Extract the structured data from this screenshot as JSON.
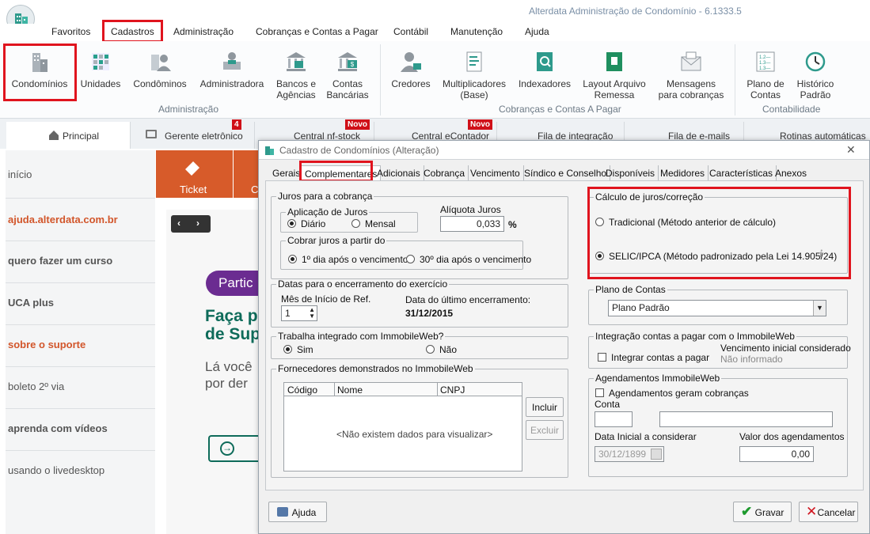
{
  "app": {
    "title": "Alterdata Administração de Condomínio - 6.1333.5"
  },
  "menu": [
    "Favoritos",
    "Cadastros",
    "Administração",
    "Cobranças e Contas a Pagar",
    "Contábil",
    "Manutenção",
    "Ajuda"
  ],
  "ribbon": {
    "condominios": "Condomínios",
    "unidades": "Unidades",
    "condominos": "Condôminos",
    "administradora": "Administradora",
    "bancos1": "Bancos e",
    "bancos2": "Agências",
    "contas1": "Contas",
    "contas2": "Bancárias",
    "credores": "Credores",
    "mult1": "Multiplicadores",
    "mult2": "(Base)",
    "indexadores": "Indexadores",
    "layout1": "Layout Arquivo",
    "layout2": "Remessa",
    "msg1": "Mensagens",
    "msg2": "para cobranças",
    "plano1": "Plano de",
    "plano2": "Contas",
    "hist1": "Histórico",
    "hist2": "Padrão",
    "group_admin": "Administração",
    "group_cob": "Cobranças e Contas A Pagar",
    "group_cont": "Contabilidade"
  },
  "tabs": {
    "principal": "Principal",
    "gerente": "Gerente eletrônico",
    "gerente_badge": "4",
    "estoque": "Central nf-stock",
    "novo1": "Novo",
    "econtador": "Central eContador",
    "novo2": "Novo",
    "integracao": "Fila de integração",
    "emails": "Fila de e-mails",
    "rotinas": "Rotinas automáticas"
  },
  "sidebar": [
    "início",
    "ajuda.alterdata.com.br",
    "quero fazer um curso",
    "UCA plus",
    "sobre o suporte",
    "boleto 2º via",
    "aprenda com vídeos",
    "usando o livedesktop"
  ],
  "main": {
    "ticket": "Ticket",
    "ticket2": "C",
    "partic": "Partic",
    "faca1": "Faça p",
    "faca2": "de Sup",
    "la1": "Lá você",
    "la2": "por der"
  },
  "dialog": {
    "title": "Cadastro de Condomínios (Alteração)",
    "tabs": [
      "Gerais",
      "Complementares",
      "Adicionais",
      "Cobrança",
      "Vencimento",
      "Síndico e Conselho",
      "Disponíveis",
      "Medidores",
      "Características",
      "Anexos"
    ],
    "juros_legend": "Juros para a cobrança",
    "aplic_legend": "Aplicação de Juros",
    "diario": "Diário",
    "mensal": "Mensal",
    "aliquota_label": "Alíquota Juros",
    "aliquota_value": "0,033",
    "pct": "%",
    "cobrar_legend": "Cobrar juros a partir do",
    "dia1": "1º dia após o vencimento",
    "dia30": "30º dia após o vencimento",
    "datas_legend": "Datas para o encerramento do exercício",
    "mes_label": "Mês de Início de Ref.",
    "mes_value": "1",
    "ult_label": "Data do último encerramento:",
    "ult_value": "31/12/2015",
    "trab_legend": "Trabalha integrado com ImmobileWeb?",
    "sim": "Sim",
    "nao": "Não",
    "forn_legend": "Fornecedores demonstrados no ImmobileWeb",
    "col_codigo": "Código",
    "col_nome": "Nome",
    "col_cnpj": "CNPJ",
    "empty": "<Não existem dados para visualizar>",
    "incluir": "Incluir",
    "excluir": "Excluir",
    "calc_legend": "Cálculo de juros/correção",
    "tradicional": "Tradicional (Método anterior de cálculo)",
    "selic": "SELIC/IPCA (Método padronizado pela Lei 14.905/24)",
    "plano_legend": "Plano de Contas",
    "plano_value": "Plano Padrão",
    "integ_legend": "Integração contas a pagar com o ImmobileWeb",
    "integrar": "Integrar contas a pagar",
    "venc_label": "Vencimento inicial considerado",
    "venc_value": "Não informado",
    "agend_legend": "Agendamentos ImmobileWeb",
    "agend_chk": "Agendamentos geram cobranças",
    "conta_label": "Conta",
    "data_ini_label": "Data Inicial a considerar",
    "data_ini_value": "30/12/1899",
    "valor_label": "Valor dos agendamentos",
    "valor_value": "0,00",
    "ajuda": "Ajuda",
    "gravar": "Gravar",
    "cancelar": "Cancelar"
  }
}
